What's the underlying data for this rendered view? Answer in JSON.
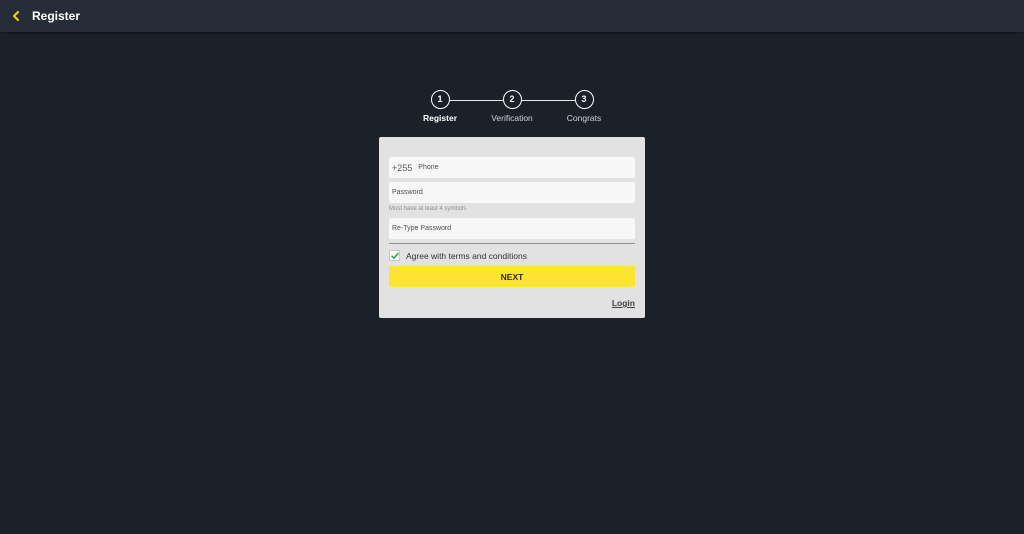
{
  "header": {
    "title": "Register",
    "back_icon": "chevron-left-icon",
    "back_icon_color": "#f5d30f"
  },
  "stepper": {
    "steps": [
      {
        "number": "1",
        "label": "Register",
        "active": true
      },
      {
        "number": "2",
        "label": "Verification",
        "active": false
      },
      {
        "number": "3",
        "label": "Congrats",
        "active": false
      }
    ]
  },
  "form": {
    "phone": {
      "prefix": "+255",
      "placeholder": "Phone",
      "value": ""
    },
    "password": {
      "placeholder": "Password",
      "value": "",
      "hint": "Must have at least 4 symbols"
    },
    "retype_password": {
      "placeholder": "Re-Type Password",
      "value": ""
    },
    "agree": {
      "label": "Agree with terms and conditions",
      "checked": true,
      "check_color": "#2ea84a"
    },
    "next_label": "NEXT",
    "login_label": "Login"
  },
  "colors": {
    "background": "#1c2029",
    "topbar": "#262d38",
    "card": "#e2e2e2",
    "primary_button": "#fde42e"
  }
}
